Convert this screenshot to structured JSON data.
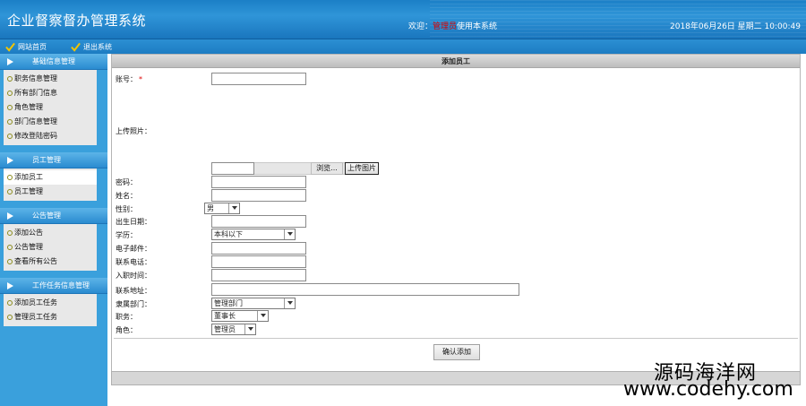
{
  "header": {
    "title": "企业督察督办管理系统",
    "welcome_prefix": "欢迎：",
    "username": "管理员",
    "welcome_suffix": "使用本系统",
    "datetime": "2018年06月26日 星期二 10:00:49"
  },
  "toolbar": {
    "home": "网站首页",
    "logout": "退出系统"
  },
  "sidebar": {
    "groups": [
      {
        "title": "基础信息管理",
        "items": [
          "职务信息管理",
          "所有部门信息",
          "角色管理",
          "部门信息管理",
          "修改登陆密码"
        ]
      },
      {
        "title": "员工管理",
        "items": [
          "添加员工",
          "员工管理"
        ]
      },
      {
        "title": "公告管理",
        "items": [
          "添加公告",
          "公告管理",
          "查看所有公告"
        ]
      },
      {
        "title": "工作任务信息管理",
        "items": [
          "添加员工任务",
          "管理员工任务"
        ]
      }
    ],
    "active_item": "添加员工"
  },
  "form": {
    "title": "添加员工",
    "account_label": "账号：",
    "required_mark": "*",
    "photo_label": "上传照片：",
    "browse_button": "浏览...",
    "upload_button": "上传图片",
    "password_label": "密码：",
    "name_label": "姓名：",
    "gender_label": "性别：",
    "gender_value": "男",
    "birth_label": "出生日期：",
    "education_label": "学历：",
    "education_value": "本科以下",
    "email_label": "电子邮件：",
    "phone_label": "联系电话：",
    "hire_label": "入职时间：",
    "address_label": "联系地址：",
    "dept_label": "隶属部门：",
    "dept_value": "管理部门",
    "position_label": "职务：",
    "position_value": "董事长",
    "role_label": "角色：",
    "role_value": "管理员",
    "submit_button": "确认添加"
  },
  "watermark": {
    "line1": "源码海洋网",
    "line2": "www.codehy.com"
  }
}
